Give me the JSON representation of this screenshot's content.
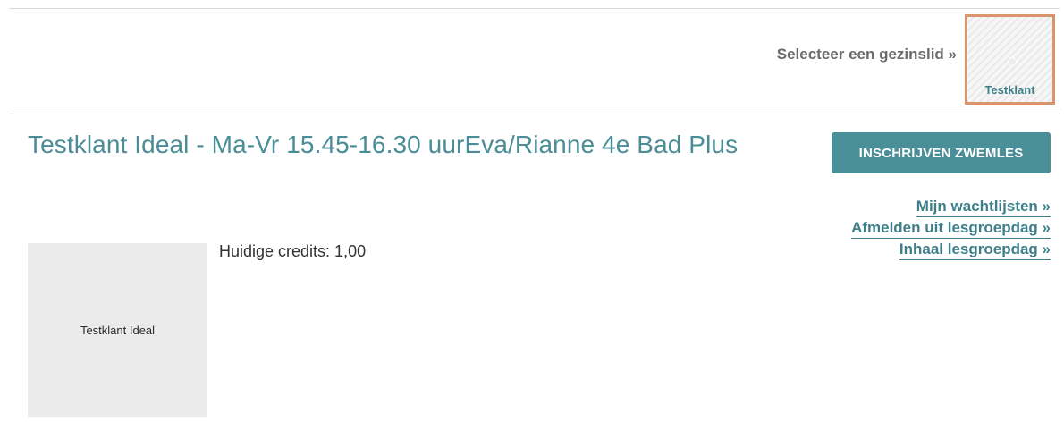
{
  "family": {
    "prompt": "Selecteer een gezinslid »",
    "member_name": "Testklant"
  },
  "main": {
    "title": "Testklant Ideal - Ma-Vr 15.45-16.30 uurEva/Rianne 4e Bad Plus",
    "register_button": "INSCHRIJVEN ZWEMLES",
    "links": [
      "Mijn wachtlijsten »",
      "Afmelden uit lesgroepdag »",
      "Inhaal lesgroepdag »"
    ],
    "photo_label": "Testklant Ideal",
    "credits": "Huidige credits: 1,00"
  }
}
